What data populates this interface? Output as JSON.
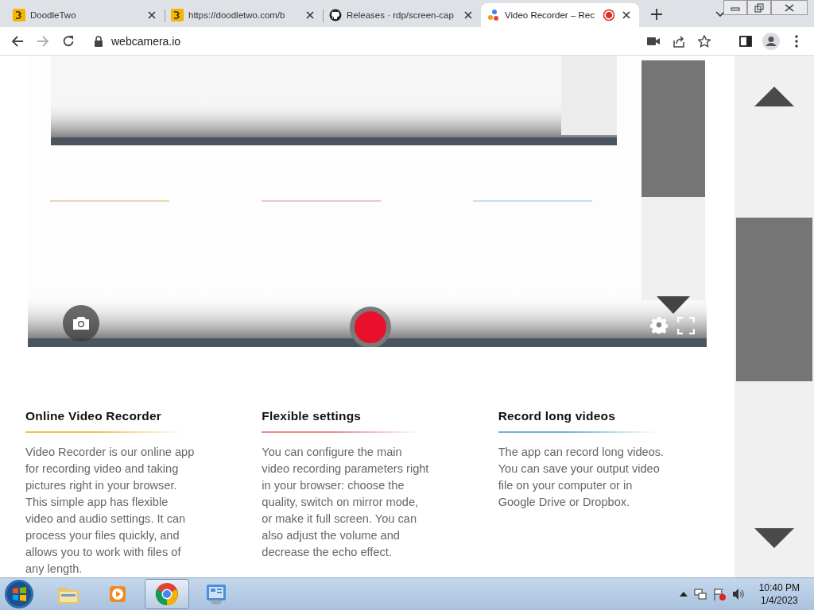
{
  "tabs": [
    {
      "kind": "doodle",
      "title": "DoodleTwo",
      "selected": false,
      "recording": false
    },
    {
      "kind": "doodle",
      "title": "https://doodletwo.com/b",
      "selected": false,
      "recording": false
    },
    {
      "kind": "github",
      "title": "Releases · rdp/screen-cap",
      "selected": false,
      "recording": false
    },
    {
      "kind": "app",
      "title": "Video Recorder – Rec",
      "selected": true,
      "recording": true
    }
  ],
  "address": "webcamera.io",
  "features": [
    {
      "heading": "Online Video Recorder",
      "color": "#f2c14e",
      "lines": [
        "Video Recorder is our online app",
        "for recording video and taking",
        "pictures right in your browser.",
        "This simple app has flexible",
        "video and audio settings. It can",
        "process your files quickly, and",
        "allows you to work with files of",
        "any length."
      ]
    },
    {
      "heading": "Flexible settings",
      "color": "#e88a8a",
      "lines": [
        "You can configure the main",
        "video recording parameters right",
        "in your browser: choose the",
        "quality, switch on mirror mode,",
        "or make it full screen. You can",
        "also adjust the volume and",
        "decrease the echo effect."
      ]
    },
    {
      "heading": "Record long videos",
      "color": "#6fb7d6",
      "lines": [
        "The app can record long videos.",
        "You can save your output video",
        "file on your computer or in",
        "Google Drive or Dropbox."
      ]
    }
  ],
  "taskbar": {
    "items": [
      {
        "kind": "explorer",
        "selected": false
      },
      {
        "kind": "media",
        "selected": false
      },
      {
        "kind": "chrome",
        "selected": true
      },
      {
        "kind": "panel",
        "selected": false
      }
    ],
    "time": "10:40 PM",
    "date": "1/4/2023"
  }
}
